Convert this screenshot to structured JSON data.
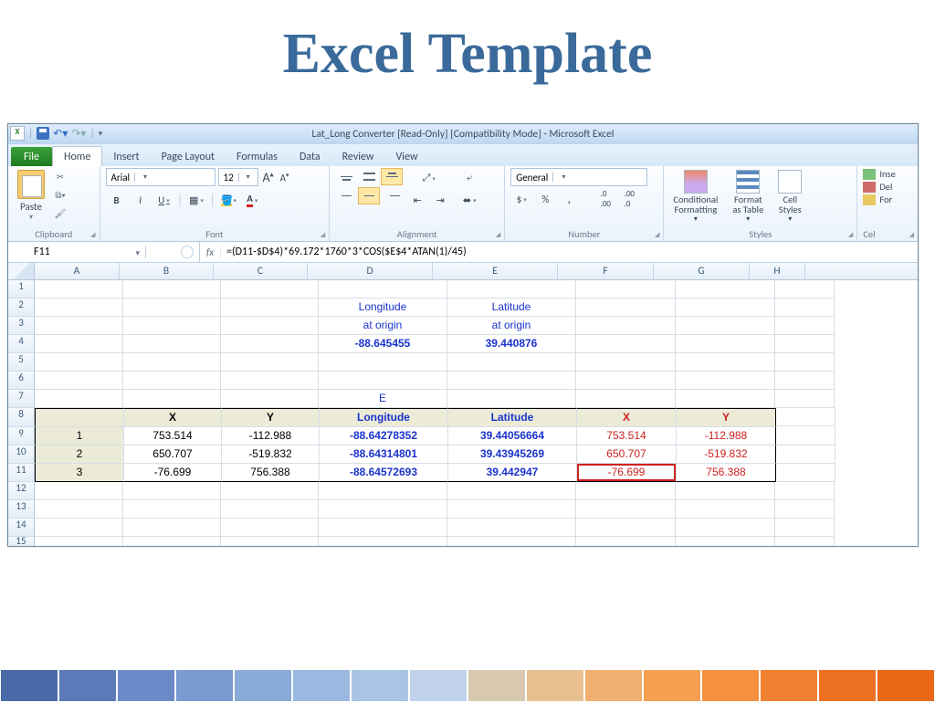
{
  "slide": {
    "title": "Excel Template"
  },
  "titlebar": {
    "text": "Lat_Long Converter  [Read-Only]  [Compatibility Mode]  -  Microsoft Excel"
  },
  "tabs": {
    "file": "File",
    "home": "Home",
    "insert": "Insert",
    "page": "Page Layout",
    "formulas": "Formulas",
    "data": "Data",
    "review": "Review",
    "view": "View"
  },
  "ribbon": {
    "clipboard": {
      "label": "Clipboard",
      "paste": "Paste"
    },
    "font": {
      "label": "Font",
      "name": "Arial",
      "size": "12",
      "b": "B",
      "i": "I",
      "u": "U"
    },
    "alignment": {
      "label": "Alignment"
    },
    "number": {
      "label": "Number",
      "format": "General",
      "dollar": "$",
      "pct": "%",
      "comma": ","
    },
    "styles": {
      "label": "Styles",
      "cond": "Conditional\nFormatting",
      "table": "Format\nas Table",
      "cell": "Cell\nStyles"
    },
    "cells": {
      "label": "Cel",
      "ins": "Inse",
      "del": "Del",
      "for": "For"
    }
  },
  "formula": {
    "name_box": "F11",
    "fx": "fx",
    "formula": "=(D11-$D$4)*69.172*1760*3*COS($E$4*ATAN(1)/45)"
  },
  "columns": [
    "A",
    "B",
    "C",
    "D",
    "E",
    "F",
    "G",
    "H"
  ],
  "rownums": [
    "1",
    "2",
    "3",
    "4",
    "5",
    "6",
    "7",
    "8",
    "9",
    "10",
    "11",
    "12",
    "13",
    "14",
    "15"
  ],
  "content": {
    "d2": "Longitude",
    "e2": "Latitude",
    "d3": "at origin",
    "e3": "at origin",
    "d4": "-88.645455",
    "e4": "39.440876",
    "d7": "E",
    "h8": {
      "a": "",
      "b": "X",
      "c": "Y",
      "d": "Longitude",
      "e": "Latitude",
      "f": "X",
      "g": "Y"
    },
    "r9": {
      "a": "1",
      "b": "753.514",
      "c": "-112.988",
      "d": "-88.64278352",
      "e": "39.44056664",
      "f": "753.514",
      "g": "-112.988"
    },
    "r10": {
      "a": "2",
      "b": "650.707",
      "c": "-519.832",
      "d": "-88.64314801",
      "e": "39.43945269",
      "f": "650.707",
      "g": "-519.832"
    },
    "r11": {
      "a": "3",
      "b": "-76.699",
      "c": "756.388",
      "d": "-88.64572693",
      "e": "39.442947",
      "f": "-76.699",
      "g": "756.388"
    }
  }
}
